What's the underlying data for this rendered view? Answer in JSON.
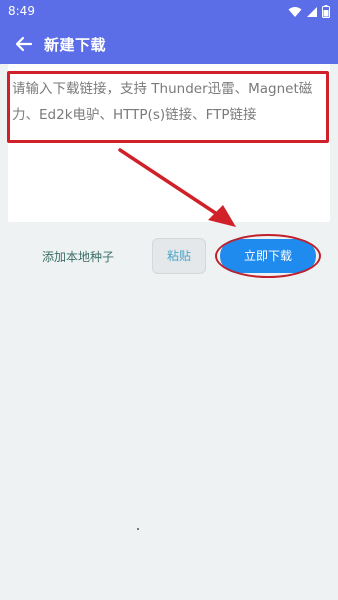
{
  "status": {
    "time": "8:49",
    "icons": [
      "wifi-icon",
      "signal-icon",
      "battery-icon"
    ]
  },
  "appbar": {
    "title": "新建下载",
    "back_icon": "arrow-left-icon"
  },
  "input": {
    "placeholder": "请输入下载链接，支持 Thunder迅雷、Magnet磁力、Ed2k电驴、HTTP(s)链接、FTP链接",
    "value": ""
  },
  "actions": {
    "add_seed": "添加本地种子",
    "paste": "粘贴",
    "download": "立即下载"
  },
  "colors": {
    "appbar": "#5b6ee8",
    "download_button": "#1f8bef",
    "annotation": "#d0212a",
    "background": "#eef2f3"
  }
}
